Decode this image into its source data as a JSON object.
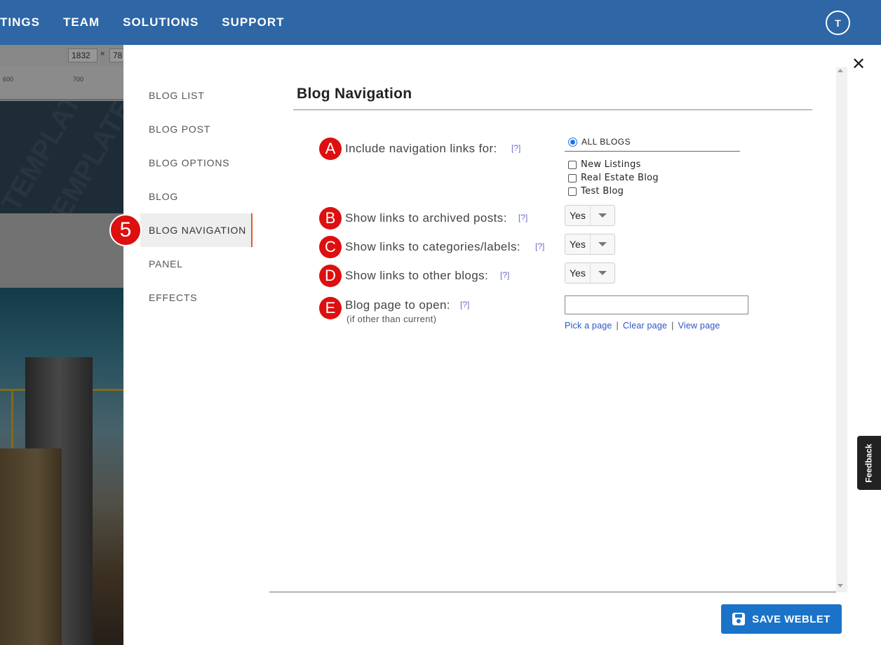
{
  "topnav": {
    "items": [
      "TINGS",
      "TEAM",
      "SOLUTIONS",
      "SUPPORT"
    ],
    "avatar_initial": "T"
  },
  "editor_bg": {
    "width_value": "1832",
    "times_sign": "×",
    "height_value": "78",
    "ruler_marks": [
      "600",
      "700"
    ],
    "watermark": "TEMPLATE"
  },
  "sidenav": {
    "items": [
      "BLOG LIST",
      "BLOG POST",
      "BLOG OPTIONS",
      "BLOG",
      "BLOG NAVIGATION",
      "PANEL",
      "EFFECTS"
    ],
    "active_index": 4,
    "step_badge": "5"
  },
  "panel": {
    "title": "Blog Navigation",
    "help_marker": "[?]",
    "fields": {
      "a": {
        "badge": "A",
        "label": "Include navigation links for:"
      },
      "b": {
        "badge": "B",
        "label": "Show links to archived posts:",
        "value": "Yes"
      },
      "c": {
        "badge": "C",
        "label": "Show links to categories/labels:",
        "value": "Yes"
      },
      "d": {
        "badge": "D",
        "label": "Show links to other blogs:",
        "value": "Yes"
      },
      "e": {
        "badge": "E",
        "label": "Blog page to open:",
        "sublabel": "(if other than current)",
        "input_value": ""
      }
    },
    "radio_all": "ALL BLOGS",
    "blogs": [
      "New Listings",
      "Real Estate Blog",
      "Test Blog"
    ],
    "page_links": [
      "Pick a page",
      "Clear page",
      "View page"
    ],
    "link_separator": "|"
  },
  "feedback": "Feedback",
  "save_button": "SAVE WEBLET",
  "colors": {
    "topbar": "#2e66a6",
    "accent_red": "#dd0f0f",
    "save": "#1a73c9",
    "active_border": "#e05a2b"
  },
  "icons": {
    "close": "close-icon",
    "save": "save-disk-icon"
  }
}
